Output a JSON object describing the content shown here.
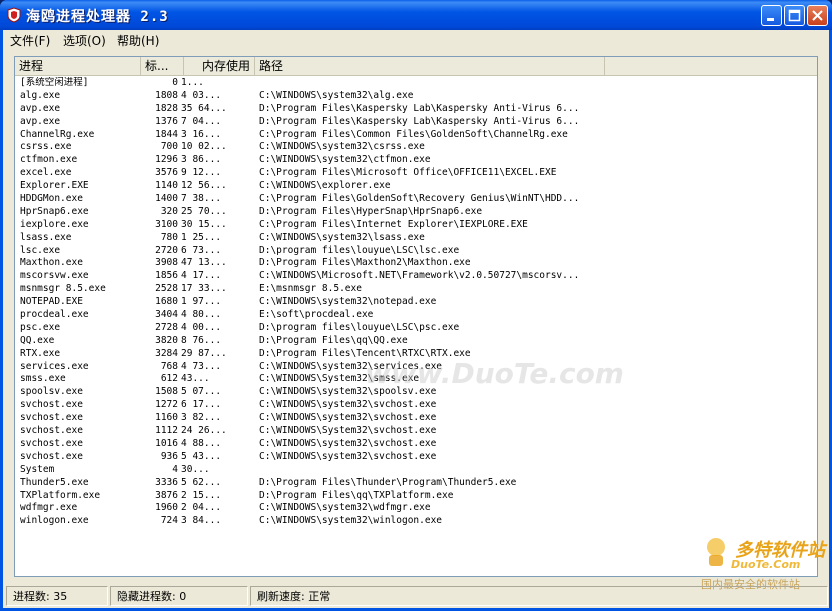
{
  "window": {
    "title": "海鸥进程处理器 2.3"
  },
  "menu": [
    {
      "label": "文件(F)"
    },
    {
      "label": "选项(O)"
    },
    {
      "label": "帮助(H)"
    }
  ],
  "list": {
    "columns": [
      "进程",
      "标...",
      "内存使用",
      "路径"
    ],
    "rows": [
      {
        "name": "[系统空闲进程]",
        "pid": "0",
        "mem": "1...",
        "path": ""
      },
      {
        "name": "alg.exe",
        "pid": "1808",
        "mem": "4 03...",
        "path": "C:\\WINDOWS\\system32\\alg.exe"
      },
      {
        "name": "avp.exe",
        "pid": "1828",
        "mem": "35 64...",
        "path": "D:\\Program Files\\Kaspersky Lab\\Kaspersky Anti-Virus 6..."
      },
      {
        "name": "avp.exe",
        "pid": "1376",
        "mem": "7 04...",
        "path": "D:\\Program Files\\Kaspersky Lab\\Kaspersky Anti-Virus 6..."
      },
      {
        "name": "ChannelRg.exe",
        "pid": "1844",
        "mem": "3 16...",
        "path": "C:\\Program Files\\Common Files\\GoldenSoft\\ChannelRg.exe"
      },
      {
        "name": "csrss.exe",
        "pid": "700",
        "mem": "10 02...",
        "path": "C:\\WINDOWS\\system32\\csrss.exe"
      },
      {
        "name": "ctfmon.exe",
        "pid": "1296",
        "mem": "3 86...",
        "path": "C:\\WINDOWS\\system32\\ctfmon.exe"
      },
      {
        "name": "excel.exe",
        "pid": "3576",
        "mem": "9 12...",
        "path": "C:\\Program Files\\Microsoft Office\\OFFICE11\\EXCEL.EXE"
      },
      {
        "name": "Explorer.EXE",
        "pid": "1140",
        "mem": "12 56...",
        "path": "C:\\WINDOWS\\explorer.exe"
      },
      {
        "name": "HDDGMon.exe",
        "pid": "1400",
        "mem": "7 38...",
        "path": "C:\\Program Files\\GoldenSoft\\Recovery Genius\\WinNT\\HDD..."
      },
      {
        "name": "HprSnap6.exe",
        "pid": "320",
        "mem": "25 70...",
        "path": "D:\\Program Files\\HyperSnap\\HprSnap6.exe"
      },
      {
        "name": "iexplore.exe",
        "pid": "3100",
        "mem": "30 15...",
        "path": "C:\\Program Files\\Internet Explorer\\IEXPLORE.EXE"
      },
      {
        "name": "lsass.exe",
        "pid": "780",
        "mem": "1 25...",
        "path": "C:\\WINDOWS\\system32\\lsass.exe"
      },
      {
        "name": "lsc.exe",
        "pid": "2720",
        "mem": "6 73...",
        "path": "D:\\program files\\louyue\\LSC\\lsc.exe"
      },
      {
        "name": "Maxthon.exe",
        "pid": "3908",
        "mem": "47 13...",
        "path": "D:\\Program Files\\Maxthon2\\Maxthon.exe"
      },
      {
        "name": "mscorsvw.exe",
        "pid": "1856",
        "mem": "4 17...",
        "path": "C:\\WINDOWS\\Microsoft.NET\\Framework\\v2.0.50727\\mscorsv..."
      },
      {
        "name": "msnmsgr 8.5.exe",
        "pid": "2528",
        "mem": "17 33...",
        "path": "E:\\msnmsgr 8.5.exe"
      },
      {
        "name": "NOTEPAD.EXE",
        "pid": "1680",
        "mem": "1 97...",
        "path": "C:\\WINDOWS\\system32\\notepad.exe"
      },
      {
        "name": "procdeal.exe",
        "pid": "3404",
        "mem": "4 80...",
        "path": "E:\\soft\\procdeal.exe"
      },
      {
        "name": "psc.exe",
        "pid": "2728",
        "mem": "4 00...",
        "path": "D:\\program files\\louyue\\LSC\\psc.exe"
      },
      {
        "name": "QQ.exe",
        "pid": "3820",
        "mem": "8 76...",
        "path": "D:\\Program Files\\qq\\QQ.exe"
      },
      {
        "name": "RTX.exe",
        "pid": "3284",
        "mem": "29 87...",
        "path": "D:\\Program Files\\Tencent\\RTXC\\RTX.exe"
      },
      {
        "name": "services.exe",
        "pid": "768",
        "mem": "4 73...",
        "path": "C:\\WINDOWS\\system32\\services.exe"
      },
      {
        "name": "smss.exe",
        "pid": "612",
        "mem": "43...",
        "path": "C:\\WINDOWS\\System32\\smss.exe"
      },
      {
        "name": "spoolsv.exe",
        "pid": "1508",
        "mem": "5 07...",
        "path": "C:\\WINDOWS\\system32\\spoolsv.exe"
      },
      {
        "name": "svchost.exe",
        "pid": "1272",
        "mem": "6 17...",
        "path": "C:\\WINDOWS\\system32\\svchost.exe"
      },
      {
        "name": "svchost.exe",
        "pid": "1160",
        "mem": "3 82...",
        "path": "C:\\WINDOWS\\system32\\svchost.exe"
      },
      {
        "name": "svchost.exe",
        "pid": "1112",
        "mem": "24 26...",
        "path": "C:\\WINDOWS\\System32\\svchost.exe"
      },
      {
        "name": "svchost.exe",
        "pid": "1016",
        "mem": "4 88...",
        "path": "C:\\WINDOWS\\system32\\svchost.exe"
      },
      {
        "name": "svchost.exe",
        "pid": "936",
        "mem": "5 43...",
        "path": "C:\\WINDOWS\\system32\\svchost.exe"
      },
      {
        "name": "System",
        "pid": "4",
        "mem": "30...",
        "path": ""
      },
      {
        "name": "Thunder5.exe",
        "pid": "3336",
        "mem": "5 62...",
        "path": "D:\\Program Files\\Thunder\\Program\\Thunder5.exe"
      },
      {
        "name": "TXPlatform.exe",
        "pid": "3876",
        "mem": "2 15...",
        "path": "D:\\Program Files\\qq\\TXPlatform.exe"
      },
      {
        "name": "wdfmgr.exe",
        "pid": "1960",
        "mem": "2 04...",
        "path": "C:\\WINDOWS\\system32\\wdfmgr.exe"
      },
      {
        "name": "winlogon.exe",
        "pid": "724",
        "mem": "3 84...",
        "path": "C:\\WINDOWS\\system32\\winlogon.exe"
      }
    ]
  },
  "status": {
    "process_count": "进程数: 35",
    "hidden_count": "隐藏进程数: 0",
    "refresh_speed": "刷新速度: 正常"
  },
  "watermark": {
    "center": "www.DuoTe.com",
    "logo_big": "多特软件站",
    "logo_url": "DuoTe.Com",
    "logo_slogan": "国内最安全的软件站"
  }
}
